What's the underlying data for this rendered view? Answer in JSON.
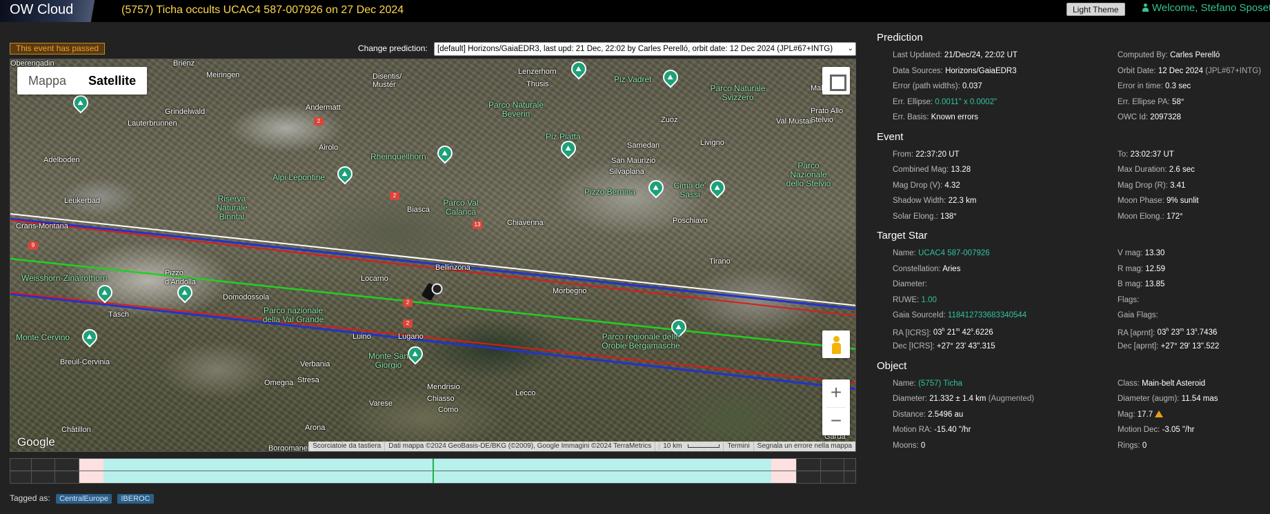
{
  "header": {
    "logo": "OW Cloud",
    "title": "(5757) Ticha occults UCAC4 587-007926 on 27 Dec 2024",
    "theme_button": "Light Theme",
    "welcome": "Welcome, Stefano Sposetti"
  },
  "status_badge": "This event has passed",
  "prediction_select": {
    "label": "Change prediction:",
    "value": "[default] Horizons/GaiaEDR3, last upd: 21 Dec, 22:02 by Carles Perelló, orbit date: 12 Dec 2024 (JPL#67+INTG)"
  },
  "map": {
    "type_buttons": [
      "Mappa",
      "Satellite"
    ],
    "active_type": "Satellite",
    "google": "Google",
    "attribution": {
      "shortcuts": "Scorciatoie da tastiera",
      "data": "Dati mappa ©2024 GeoBasis-DE/BKG (©2009), Google Immagini ©2024 TerraMetrics",
      "scale": "10 km",
      "terms": "Termini",
      "report": "Segnala un errore nella mappa"
    },
    "places": [
      "Brienz",
      "Meiringen",
      "Disentis/ Mustér",
      "Lenzerhorn",
      "Thusis",
      "Piz Vadret",
      "Parco Naturale Svizzero",
      "Mallets Val",
      "Grindelwald",
      "Andermatt",
      "Parco Naturale Beverin",
      "Zuoz",
      "Prato Allo Stelvio",
      "Lauterbrunnen",
      "Airolo",
      "Piz Platta",
      "Samedan",
      "Val Müstair",
      "Rheinquellhorn",
      "San Maurizio",
      "Livigno",
      "Adelboden",
      "Silvaplana",
      "Parco Nazionale dello Stelvio",
      "Alpi Lepontine",
      "Pizzo Bernina",
      "Cima de' Sassi",
      "Leukerbad",
      "Riserva Naturale Binntal",
      "Biasca",
      "Parco Val Calanca",
      "Poschiavo",
      "Chiavenna",
      "Crans-Montana",
      "Bellinzona",
      "Tirano",
      "Weisshorn-Zinalrothorn",
      "Pizzo d'Andolla",
      "Locarno",
      "Morbegno",
      "Domodossola",
      "Täsch",
      "Parco nazionale della Val Grande",
      "Monte Cervino",
      "Luino",
      "Lugano",
      "Parco regionale delle Orobie Bergamasche",
      "Breuil-Cervinia",
      "Verbania",
      "Monte San Giorgio",
      "Omegna",
      "Stresa",
      "Mendrisio",
      "Varese",
      "Chiasso",
      "Como",
      "Lecco",
      "Châtillon",
      "Arona",
      "Borgomanero",
      "Garda",
      "Oberengadin"
    ],
    "road_signs": [
      "2",
      "2",
      "13",
      "9",
      "2",
      "2"
    ]
  },
  "tags": {
    "label": "Tagged as:",
    "items": [
      "CentralEurope",
      "IBEROC"
    ]
  },
  "prediction": {
    "title": "Prediction",
    "left": [
      {
        "k": "Last Updated:",
        "v": "21/Dec/24, 22:02 UT"
      },
      {
        "k": "Data Sources:",
        "v": "Horizons/GaiaEDR3"
      },
      {
        "k": "Error (path widths):",
        "v": "0.037"
      },
      {
        "k": "Err. Ellipse:",
        "v": "0.0011\" x 0.0002\"",
        "style": "link"
      },
      {
        "k": "Err. Basis:",
        "v": "Known errors"
      }
    ],
    "right": [
      {
        "k": "Computed By:",
        "v": "Carles Perelló"
      },
      {
        "k": "Orbit Date:",
        "v": "12 Dec 2024",
        "extra": "(JPL#67+INTG)"
      },
      {
        "k": "Error in time:",
        "v": "0.3 sec"
      },
      {
        "k": "Err. Ellipse PA:",
        "v": "58°"
      },
      {
        "k": "OWC Id:",
        "v": "2097328"
      }
    ]
  },
  "event": {
    "title": "Event",
    "left": [
      {
        "k": "From:",
        "v": "22:37:20 UT"
      },
      {
        "k": "Combined Mag:",
        "v": "13.28"
      },
      {
        "k": "Mag Drop (V):",
        "v": "4.32"
      },
      {
        "k": "Shadow Width:",
        "v": "22.3 km"
      },
      {
        "k": "Solar Elong.:",
        "v": "138°"
      }
    ],
    "right": [
      {
        "k": "To:",
        "v": "23:02:37 UT"
      },
      {
        "k": "Max Duration:",
        "v": "2.6 sec"
      },
      {
        "k": "Mag Drop (R):",
        "v": "3.41"
      },
      {
        "k": "Moon Phase:",
        "v": "9% sunlit"
      },
      {
        "k": "Moon Elong.:",
        "v": "172°"
      }
    ]
  },
  "target_star": {
    "title": "Target Star",
    "left": [
      {
        "k": "Name:",
        "v": "UCAC4 587-007926",
        "style": "link"
      },
      {
        "k": "Constellation:",
        "v": "Aries"
      },
      {
        "k": "Diameter:",
        "v": ""
      },
      {
        "k": "RUWE:",
        "v": "1.00",
        "style": "link"
      },
      {
        "k": "Gaia SourceId:",
        "v": "118412733683340544",
        "style": "link"
      },
      {
        "k": "RA [ICRS]:",
        "v": "03h 21m 42s.6226"
      },
      {
        "k": "Dec [ICRS]:",
        "v": "+27° 23' 43\".315"
      }
    ],
    "right": [
      {
        "k": "V mag:",
        "v": "13.30"
      },
      {
        "k": "R mag:",
        "v": "12.59"
      },
      {
        "k": "B mag:",
        "v": "13.85"
      },
      {
        "k": "Flags:",
        "v": ""
      },
      {
        "k": "Gaia Flags:",
        "v": ""
      },
      {
        "k": "RA [aprnt]:",
        "v": "03h 23m 13s.7436"
      },
      {
        "k": "Dec [aprnt]:",
        "v": "+27° 29' 13\".522"
      }
    ]
  },
  "object": {
    "title": "Object",
    "left": [
      {
        "k": "Name:",
        "v": "(5757) Ticha",
        "style": "link"
      },
      {
        "k": "Diameter:",
        "v": "21.332 ± 1.4 km",
        "extra": "(Augmented)"
      },
      {
        "k": "Distance:",
        "v": "2.5496 au"
      },
      {
        "k": "Motion RA:",
        "v": "-15.40 \"/hr"
      },
      {
        "k": "Moons:",
        "v": "0"
      }
    ],
    "right": [
      {
        "k": "Class:",
        "v": "Main-belt Asteroid"
      },
      {
        "k": "Diameter (augm):",
        "v": "11.54 mas"
      },
      {
        "k": "Mag:",
        "v": "17.7",
        "icon": "warning-icon"
      },
      {
        "k": "Motion Dec:",
        "v": "-3.05 \"/hr"
      },
      {
        "k": "Rings:",
        "v": "0"
      }
    ]
  },
  "colors": {
    "accent_green": "#30c3a0",
    "title_yellow": "#ffd84a",
    "path_center": "#00cc00",
    "path_edges": "#2233cc",
    "path_error": "#dd1a1a",
    "path_sigma": "#ffffff"
  }
}
